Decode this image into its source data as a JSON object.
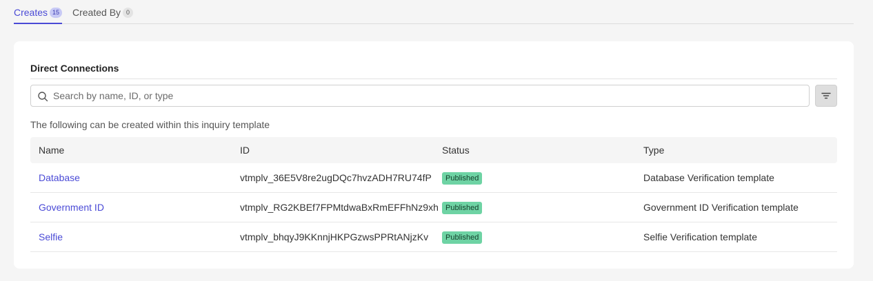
{
  "tabs": [
    {
      "label": "Creates",
      "count": "15",
      "active": true
    },
    {
      "label": "Created By",
      "count": "0",
      "active": false
    }
  ],
  "card": {
    "title": "Direct Connections",
    "search_placeholder": "Search by name, ID, or type",
    "description": "The following can be created within this inquiry template"
  },
  "table": {
    "headers": [
      "Name",
      "ID",
      "Status",
      "Type"
    ],
    "rows": [
      {
        "name": "Database",
        "id": "vtmplv_36E5V8re2ugDQc7hvzADH7RU74fP",
        "status": "Published",
        "type": "Database Verification template"
      },
      {
        "name": "Government ID",
        "id": "vtmplv_RG2KBEf7FPMtdwaBxRmEFFhNz9xh",
        "status": "Published",
        "type": "Government ID Verification template"
      },
      {
        "name": "Selfie",
        "id": "vtmplv_bhqyJ9KKnnjHKPGzwsPPRtANjzKv",
        "status": "Published",
        "type": "Selfie Verification template"
      }
    ]
  },
  "colors": {
    "accent": "#4a4ad6",
    "published_badge": "#6ed3a4"
  },
  "icons": {
    "search": "search-icon",
    "filter": "filter-icon"
  }
}
